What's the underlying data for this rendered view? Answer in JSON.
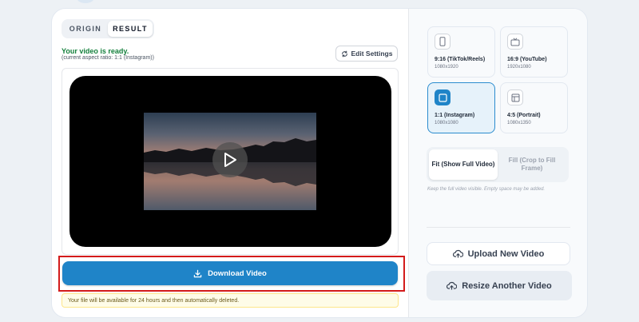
{
  "tabs": [
    {
      "label": "ORIGIN",
      "active": false
    },
    {
      "label": "RESULT",
      "active": true
    }
  ],
  "status": {
    "title": "Your video is ready.",
    "subtitle": "(current aspect ratio: 1:1 (Instagram))"
  },
  "edit_settings_label": "Edit Settings",
  "download_label": "Download Video",
  "notice": "Your file will be available for 24 hours and then automatically deleted.",
  "ratios": [
    {
      "label": "9:16 (TikTok/Reels)",
      "size": "1080x1920",
      "icon": "phone-portrait-icon",
      "selected": false
    },
    {
      "label": "16:9 (YouTube)",
      "size": "1920x1080",
      "icon": "tv-icon",
      "selected": false
    },
    {
      "label": "1:1 (Instagram)",
      "size": "1080x1080",
      "icon": "square-icon",
      "selected": true
    },
    {
      "label": "4:5 (Portrait)",
      "size": "1080x1350",
      "icon": "layout-icon",
      "selected": false
    }
  ],
  "fit_options": [
    {
      "label": "Fit (Show Full Video)",
      "active": true
    },
    {
      "label": "Fill (Crop to Fill Frame)",
      "active": false
    }
  ],
  "fit_hint": "Keep the full video visible. Empty space may be added.",
  "upload_label": "Upload New Video",
  "resize_label": "Resize Another Video",
  "colors": {
    "accent": "#1f84c8",
    "success": "#15803d",
    "highlight_border": "#d31b1b"
  }
}
